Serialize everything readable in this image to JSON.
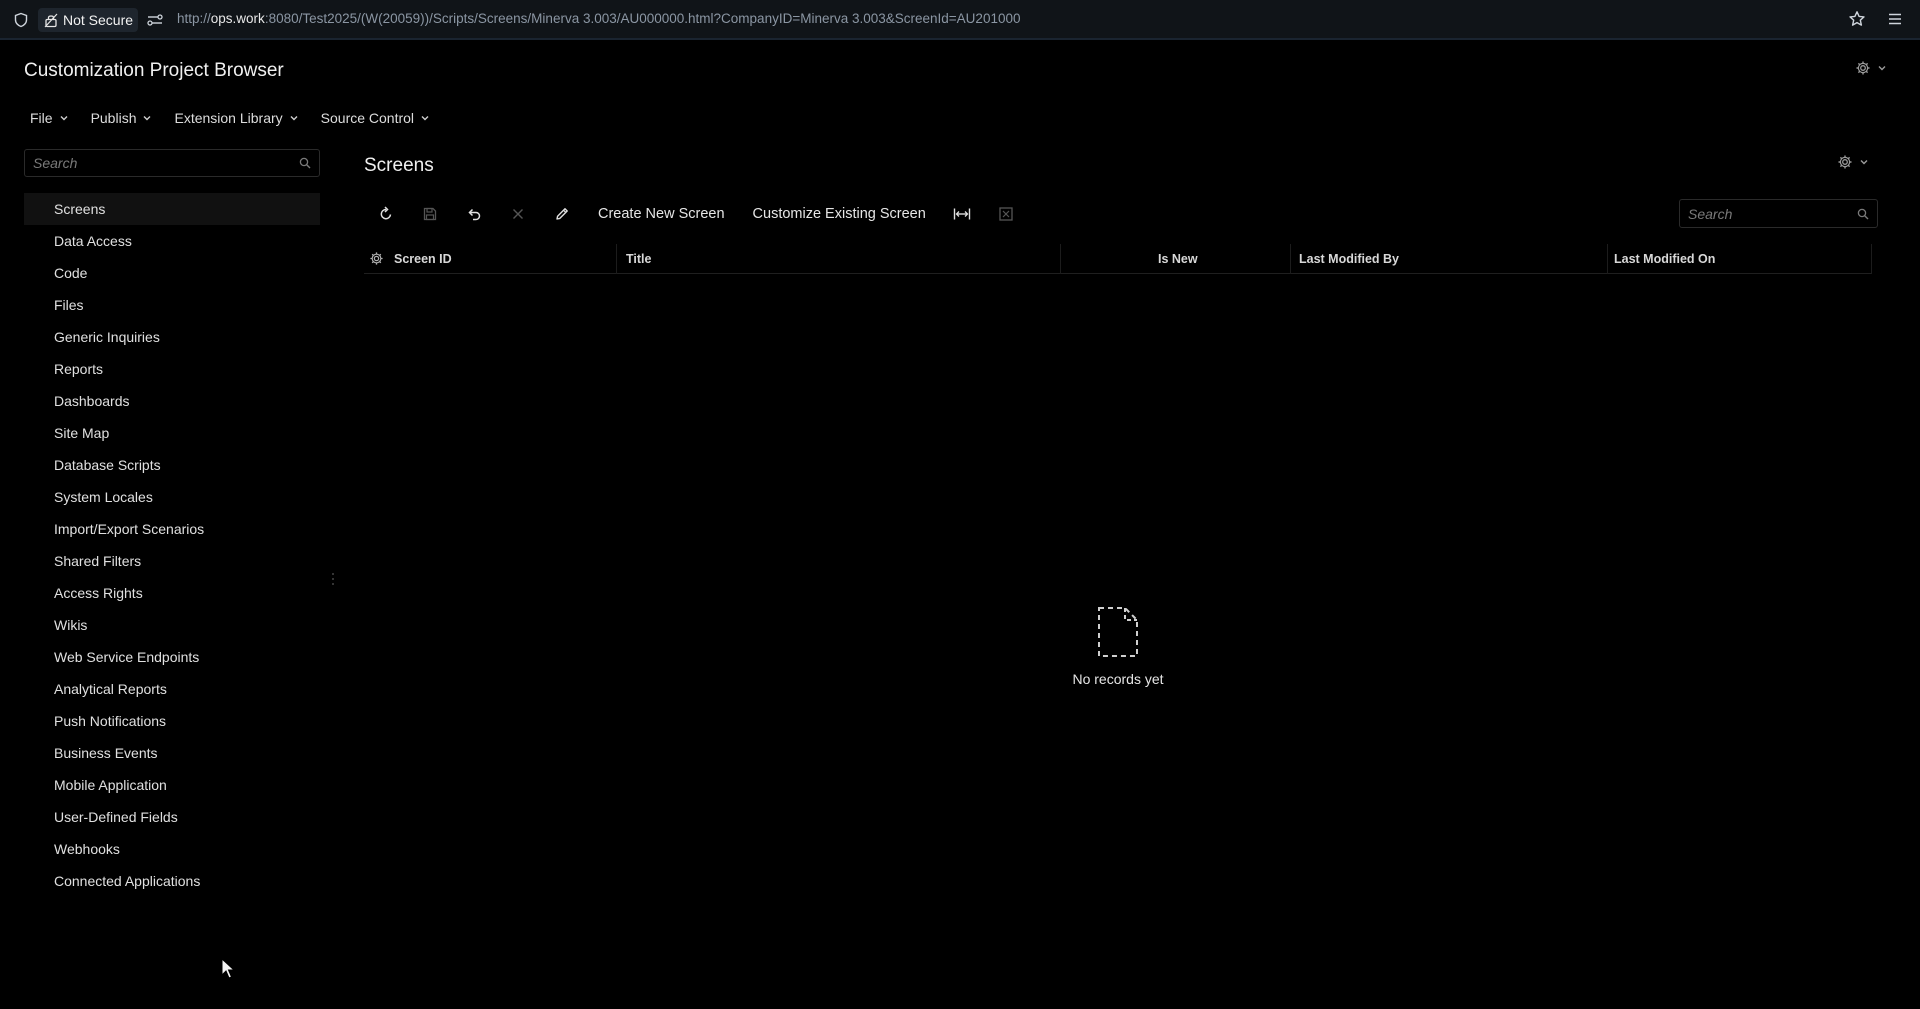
{
  "browser": {
    "security_label": "Not Secure",
    "url_prefix": "http://",
    "url_host": "ops.work",
    "url_rest": ":8080/Test2025/(W(20059))/Scripts/Screens/Minerva 3.003/AU000000.html?CompanyID=Minerva 3.003&ScreenId=AU201000"
  },
  "app": {
    "title": "Customization Project Browser"
  },
  "menubar": {
    "items": [
      {
        "label": "File"
      },
      {
        "label": "Publish"
      },
      {
        "label": "Extension Library"
      },
      {
        "label": "Source Control"
      }
    ]
  },
  "sidebar": {
    "search_placeholder": "Search",
    "items": [
      {
        "label": "Screens"
      },
      {
        "label": "Data Access"
      },
      {
        "label": "Code"
      },
      {
        "label": "Files"
      },
      {
        "label": "Generic Inquiries"
      },
      {
        "label": "Reports"
      },
      {
        "label": "Dashboards"
      },
      {
        "label": "Site Map"
      },
      {
        "label": "Database Scripts"
      },
      {
        "label": "System Locales"
      },
      {
        "label": "Import/Export Scenarios"
      },
      {
        "label": "Shared Filters"
      },
      {
        "label": "Access Rights"
      },
      {
        "label": "Wikis"
      },
      {
        "label": "Web Service Endpoints"
      },
      {
        "label": "Analytical Reports"
      },
      {
        "label": "Push Notifications"
      },
      {
        "label": "Business Events"
      },
      {
        "label": "Mobile Application"
      },
      {
        "label": "User-Defined Fields"
      },
      {
        "label": "Webhooks"
      },
      {
        "label": "Connected Applications"
      }
    ],
    "active_index": 0
  },
  "main": {
    "title": "Screens",
    "toolbar": {
      "create_label": "Create New Screen",
      "customize_label": "Customize Existing Screen"
    },
    "grid_search_placeholder": "Search",
    "columns": {
      "screen_id": "Screen ID",
      "title": "Title",
      "is_new": "Is New",
      "last_modified_by": "Last Modified By",
      "last_modified_on": "Last Modified On"
    },
    "empty_text": "No records yet"
  },
  "colors": {
    "background": "#000000",
    "urlbar": "#101418",
    "active_nav": "#111111",
    "text": "#e6e6e6"
  }
}
